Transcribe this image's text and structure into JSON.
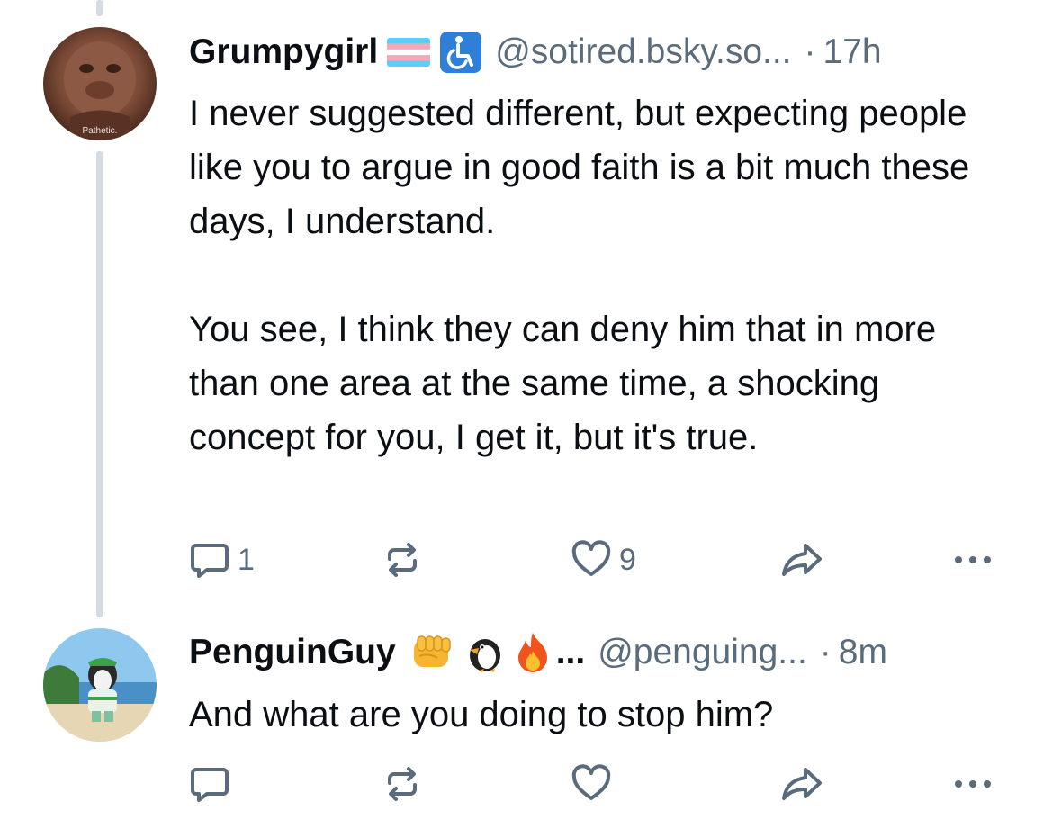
{
  "posts": [
    {
      "display_name": "Grumpygirl",
      "badges": [
        "transgender-flag-icon",
        "wheelchair-icon"
      ],
      "handle": "@sotired.bsky.so...",
      "separator": "·",
      "time": "17h",
      "avatar_caption": "Pathetic.",
      "paragraphs": [
        "I never suggested different, but expecting people like you to argue in good faith is a bit much these days, I understand.",
        "You see, I think they can deny him that in more than one area at the same time, a shocking concept for you, I get it, but it's true."
      ],
      "reply_count": "1",
      "like_count": "9"
    },
    {
      "display_name": "PenguinGuy",
      "badges": [
        "fist-icon",
        "penguin-icon",
        "fire-icon"
      ],
      "truncation": "...",
      "handle": "@penguing...",
      "separator": "·",
      "time": "8m",
      "paragraphs": [
        "And what are you doing to stop him?"
      ]
    }
  ],
  "colors": {
    "text": "#0b0f14",
    "muted": "#5a6b7c",
    "thread_line": "#d4dbe2"
  }
}
